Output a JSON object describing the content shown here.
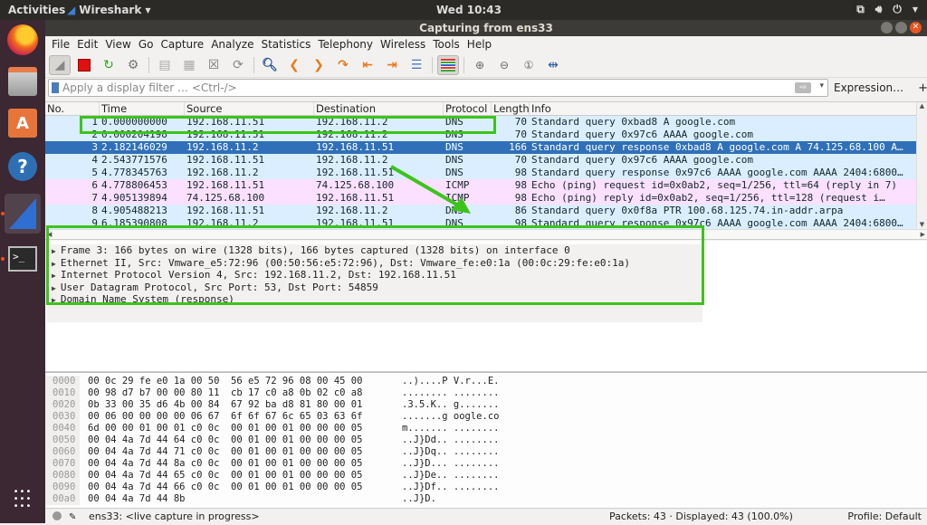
{
  "topbar": {
    "activities": "Activities",
    "app_name": "Wireshark",
    "clock": "Wed 10:43",
    "tray_icons": [
      "network-icon",
      "volume-icon",
      "power-icon",
      "chevron-down-icon"
    ]
  },
  "dock": {
    "items": [
      {
        "name": "firefox",
        "icon": "firefox-icon"
      },
      {
        "name": "files",
        "icon": "file-cabinet-icon"
      },
      {
        "name": "software",
        "icon": "shopping-bag-icon"
      },
      {
        "name": "help",
        "icon": "help-icon"
      },
      {
        "name": "wireshark",
        "icon": "wireshark-fin-icon",
        "active": true
      },
      {
        "name": "terminal",
        "icon": "terminal-icon"
      }
    ],
    "apps_grid_icon": "apps-grid-icon"
  },
  "window": {
    "title": "Capturing from ens33"
  },
  "menu": [
    "File",
    "Edit",
    "View",
    "Go",
    "Capture",
    "Analyze",
    "Statistics",
    "Telephony",
    "Wireless",
    "Tools",
    "Help"
  ],
  "toolbar": {
    "buttons": [
      "start-capture",
      "stop-capture",
      "restart-capture",
      "capture-options",
      "open-file",
      "save-file",
      "close-file",
      "reload-file",
      "find-packet",
      "go-back",
      "go-forward",
      "go-to-packet",
      "go-first",
      "go-last",
      "autoscroll",
      "colorize",
      "zoom-in",
      "zoom-out",
      "normal-size",
      "resize-columns"
    ]
  },
  "filter": {
    "placeholder": "Apply a display filter … <Ctrl-/>",
    "value": "",
    "expression_label": "Expression…",
    "add_label": "+"
  },
  "packet_list": {
    "columns": [
      "No.",
      "Time",
      "Source",
      "Destination",
      "Protocol",
      "Length",
      "Info"
    ],
    "rows": [
      {
        "no": "1",
        "time": "0.000000000",
        "src": "192.168.11.51",
        "dst": "192.168.11.2",
        "proto": "DNS",
        "len": "70",
        "info": "Standard query 0xbad8 A google.com",
        "type": "dns"
      },
      {
        "no": "2",
        "time": "0.000204198",
        "src": "192.168.11.51",
        "dst": "192.168.11.2",
        "proto": "DNS",
        "len": "70",
        "info": "Standard query 0x97c6 AAAA google.com",
        "type": "dns"
      },
      {
        "no": "3",
        "time": "2.182146029",
        "src": "192.168.11.2",
        "dst": "192.168.11.51",
        "proto": "DNS",
        "len": "166",
        "info": "Standard query response 0xbad8 A google.com A 74.125.68.100 A…",
        "type": "sel"
      },
      {
        "no": "4",
        "time": "2.543771576",
        "src": "192.168.11.51",
        "dst": "192.168.11.2",
        "proto": "DNS",
        "len": "70",
        "info": "Standard query 0x97c6 AAAA google.com",
        "type": "dns"
      },
      {
        "no": "5",
        "time": "4.778345763",
        "src": "192.168.11.2",
        "dst": "192.168.11.51",
        "proto": "DNS",
        "len": "98",
        "info": "Standard query response 0x97c6 AAAA google.com AAAA 2404:6800…",
        "type": "dns"
      },
      {
        "no": "6",
        "time": "4.778806453",
        "src": "192.168.11.51",
        "dst": "74.125.68.100",
        "proto": "ICMP",
        "len": "98",
        "info": "Echo (ping) request  id=0x0ab2, seq=1/256, ttl=64 (reply in 7)",
        "type": "icmp"
      },
      {
        "no": "7",
        "time": "4.905139894",
        "src": "74.125.68.100",
        "dst": "192.168.11.51",
        "proto": "ICMP",
        "len": "98",
        "info": "Echo (ping) reply    id=0x0ab2, seq=1/256, ttl=128 (request i…",
        "type": "icmp"
      },
      {
        "no": "8",
        "time": "4.905488213",
        "src": "192.168.11.51",
        "dst": "192.168.11.2",
        "proto": "DNS",
        "len": "86",
        "info": "Standard query 0x0f8a PTR 100.68.125.74.in-addr.arpa",
        "type": "dns"
      },
      {
        "no": "9",
        "time": "6.185390808",
        "src": "192.168.11.2",
        "dst": "192.168.11.51",
        "proto": "DNS",
        "len": "98",
        "info": "Standard query response 0x97c6 AAAA google.com AAAA 2404:6800…",
        "type": "dns"
      }
    ]
  },
  "details": [
    "Frame 3: 166 bytes on wire (1328 bits), 166 bytes captured (1328 bits) on interface 0",
    "Ethernet II, Src: Vmware_e5:72:96 (00:50:56:e5:72:96), Dst: Vmware_fe:e0:1a (00:0c:29:fe:e0:1a)",
    "Internet Protocol Version 4, Src: 192.168.11.2, Dst: 192.168.11.51",
    "User Datagram Protocol, Src Port: 53, Dst Port: 54859",
    "Domain Name System (response)"
  ],
  "bytes": [
    {
      "off": "0000",
      "hex": "00 0c 29 fe e0 1a 00 50  56 e5 72 96 08 00 45 00",
      "ascii": "..)....P V.r...E."
    },
    {
      "off": "0010",
      "hex": "00 98 d7 b7 00 00 80 11  cb 17 c0 a8 0b 02 c0 a8",
      "ascii": "........ ........"
    },
    {
      "off": "0020",
      "hex": "0b 33 00 35 d6 4b 00 84  67 92 ba d8 81 80 00 01",
      "ascii": ".3.5.K.. g......."
    },
    {
      "off": "0030",
      "hex": "00 06 00 00 00 00 06 67  6f 6f 67 6c 65 03 63 6f",
      "ascii": ".......g oogle.co"
    },
    {
      "off": "0040",
      "hex": "6d 00 00 01 00 01 c0 0c  00 01 00 01 00 00 00 05",
      "ascii": "m....... ........"
    },
    {
      "off": "0050",
      "hex": "00 04 4a 7d 44 64 c0 0c  00 01 00 01 00 00 00 05",
      "ascii": "..J}Dd.. ........"
    },
    {
      "off": "0060",
      "hex": "00 04 4a 7d 44 71 c0 0c  00 01 00 01 00 00 00 05",
      "ascii": "..J}Dq.. ........"
    },
    {
      "off": "0070",
      "hex": "00 04 4a 7d 44 8a c0 0c  00 01 00 01 00 00 00 05",
      "ascii": "..J}D... ........"
    },
    {
      "off": "0080",
      "hex": "00 04 4a 7d 44 65 c0 0c  00 01 00 01 00 00 00 05",
      "ascii": "..J}De.. ........"
    },
    {
      "off": "0090",
      "hex": "00 04 4a 7d 44 66 c0 0c  00 01 00 01 00 00 00 05",
      "ascii": "..J}Df.. ........"
    },
    {
      "off": "00a0",
      "hex": "00 04 4a 7d 44 8b",
      "ascii": "..J}D."
    }
  ],
  "status": {
    "capture": "ens33: <live capture in progress>",
    "packets": "Packets: 43 · Displayed: 43 (100.0%)",
    "profile": "Profile: Default"
  },
  "colors": {
    "dns_row": "#daeeff",
    "icmp_row": "#fce0ff",
    "selected_row": "#3070b8",
    "annotation_green": "#3cc41c"
  }
}
